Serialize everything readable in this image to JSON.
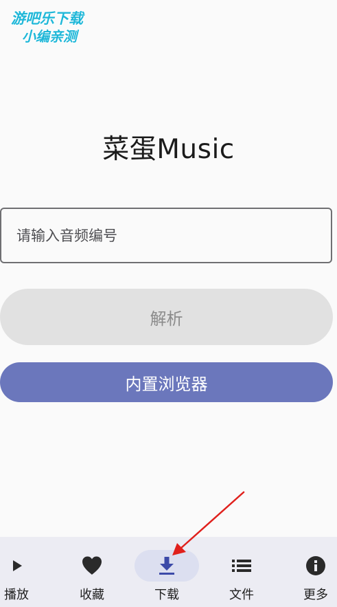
{
  "watermark": {
    "line1": "游吧乐下载",
    "line2": "小编亲测"
  },
  "app": {
    "title": "菜蛋Music"
  },
  "search": {
    "placeholder": "请输入音频编号",
    "value": ""
  },
  "buttons": {
    "parse_label": "解析",
    "browser_label": "内置浏览器"
  },
  "bottom_nav": {
    "active": "download",
    "items": [
      {
        "id": "play",
        "label": "播放",
        "icon": "play-icon"
      },
      {
        "id": "favorites",
        "label": "收藏",
        "icon": "heart-icon"
      },
      {
        "id": "download",
        "label": "下载",
        "icon": "download-icon"
      },
      {
        "id": "files",
        "label": "文件",
        "icon": "list-icon"
      },
      {
        "id": "more",
        "label": "更多",
        "icon": "info-icon"
      }
    ]
  },
  "colors": {
    "primary": "#6b77bc",
    "nav_background": "#ececf3",
    "nav_active_pill": "#dcdff0",
    "parse_button_disabled": "#e1e1e1",
    "annotation_arrow": "#e0201c",
    "watermark_text": "#1fb7d8"
  }
}
